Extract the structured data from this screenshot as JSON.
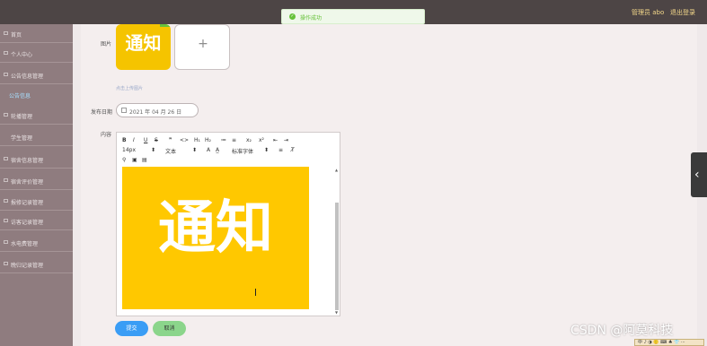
{
  "header": {
    "user_label": "管理员 abo",
    "logout_label": "退出登录"
  },
  "toast": {
    "icon": "check-circle-icon",
    "message": "操作成功"
  },
  "sidebar": {
    "items": [
      {
        "label": "首页",
        "icon": "home-icon"
      },
      {
        "label": "个人中心",
        "icon": "user-icon"
      },
      {
        "label": "公告信息管理",
        "icon": "notice-icon"
      },
      {
        "label": "公告信息",
        "icon": ""
      },
      {
        "label": "轮播管理",
        "icon": "image-icon"
      },
      {
        "label": "学生管理",
        "icon": ""
      },
      {
        "label": "宿舍信息管理",
        "icon": "building-icon"
      },
      {
        "label": "宿舍评价管理",
        "icon": "star-icon"
      },
      {
        "label": "报修记录管理",
        "icon": "tool-icon"
      },
      {
        "label": "访客记录管理",
        "icon": "visitor-icon"
      },
      {
        "label": "水电费管理",
        "icon": "water-icon"
      },
      {
        "label": "晚归记录管理",
        "icon": "moon-icon"
      }
    ]
  },
  "form": {
    "image_label": "图片",
    "image_thumb_text": "通知",
    "upload_plus": "+",
    "upload_hint": "点击上传图片",
    "date_label": "发布日期",
    "date_value": "2021 年 04 月 26 日",
    "content_label": "内容",
    "editor_image_text": "通知",
    "submit_label": "提交",
    "cancel_label": "取消"
  },
  "toolbar": {
    "bold": "B",
    "italic": "I",
    "underline": "U",
    "strike": "S",
    "quote": "❞",
    "code": "<>",
    "h1": "H₁",
    "h2": "H₂",
    "ordered_list": "≔",
    "bullet_list": "≡",
    "subscript": "x₂",
    "superscript": "x²",
    "indent_left": "⇤",
    "indent_right": "⇥",
    "font_size": "14px",
    "text_style": "文本",
    "font_color": "A",
    "bg_color": "A̲",
    "font_family": "标准字体",
    "align": "≡",
    "clear": "T̸",
    "link_icon": "link-icon",
    "image_icon": "image-icon",
    "video_icon": "video-icon"
  },
  "watermark": "CSDN @阿莫科技",
  "taskbar": "中 ♪ ◑ 🙂 ⌨ ♣ 👕 ⋯"
}
